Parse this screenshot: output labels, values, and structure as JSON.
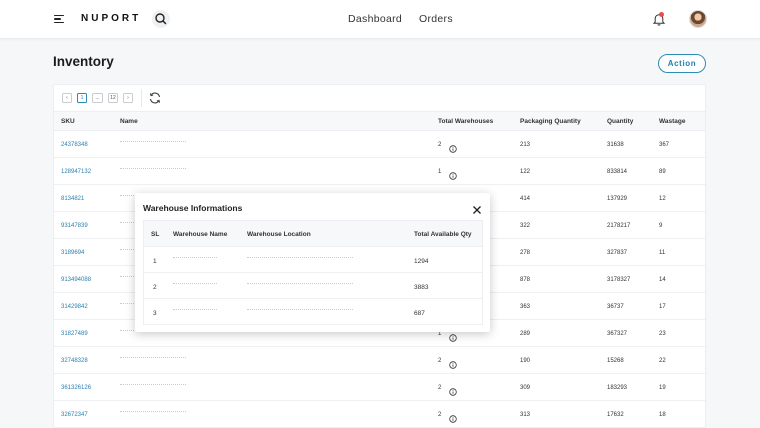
{
  "header": {
    "brand": "NUPORT",
    "nav": [
      "Dashboard",
      "Orders"
    ],
    "icons": [
      "menu-icon",
      "search-icon",
      "bell-icon",
      "avatar"
    ]
  },
  "page": {
    "title": "Inventory",
    "action_label": "Action"
  },
  "pager": {
    "prev": "‹",
    "current": "1",
    "ellipsis": "...",
    "last": "12",
    "next": "›"
  },
  "table": {
    "columns": [
      "SKU",
      "Name",
      "Total Warehouses",
      "Packaging Quantity",
      "Quantity",
      "Wastage"
    ],
    "rows": [
      {
        "sku": "24378348",
        "warehouses": "2",
        "packaging": "213",
        "quantity": "31638",
        "wastage": "367"
      },
      {
        "sku": "128947132",
        "warehouses": "1",
        "packaging": "122",
        "quantity": "833814",
        "wastage": "89"
      },
      {
        "sku": "8134821",
        "warehouses": "",
        "packaging": "414",
        "quantity": "137929",
        "wastage": "12"
      },
      {
        "sku": "93147839",
        "warehouses": "",
        "packaging": "322",
        "quantity": "2178217",
        "wastage": "9"
      },
      {
        "sku": "3189694",
        "warehouses": "",
        "packaging": "278",
        "quantity": "327837",
        "wastage": "11"
      },
      {
        "sku": "913494088",
        "warehouses": "",
        "packaging": "878",
        "quantity": "3178327",
        "wastage": "14"
      },
      {
        "sku": "31429842",
        "warehouses": "",
        "packaging": "363",
        "quantity": "36737",
        "wastage": "17"
      },
      {
        "sku": "31827489",
        "warehouses": "1",
        "packaging": "289",
        "quantity": "367327",
        "wastage": "23"
      },
      {
        "sku": "32748328",
        "warehouses": "2",
        "packaging": "190",
        "quantity": "15268",
        "wastage": "22"
      },
      {
        "sku": "361326126",
        "warehouses": "2",
        "packaging": "309",
        "quantity": "183293",
        "wastage": "19"
      },
      {
        "sku": "32672347",
        "warehouses": "2",
        "packaging": "313",
        "quantity": "17632",
        "wastage": "18"
      }
    ]
  },
  "modal": {
    "title": "Warehouse Informations",
    "columns": [
      "SL",
      "Warehouse Name",
      "Warehouse Location",
      "Total Available Qty"
    ],
    "rows": [
      {
        "sl": "1",
        "qty": "1294"
      },
      {
        "sl": "2",
        "qty": "3883"
      },
      {
        "sl": "3",
        "qty": "687"
      }
    ]
  },
  "colors": {
    "accent": "#2d8cb3",
    "link": "#2b7fb0",
    "notification": "#e94b4b"
  }
}
